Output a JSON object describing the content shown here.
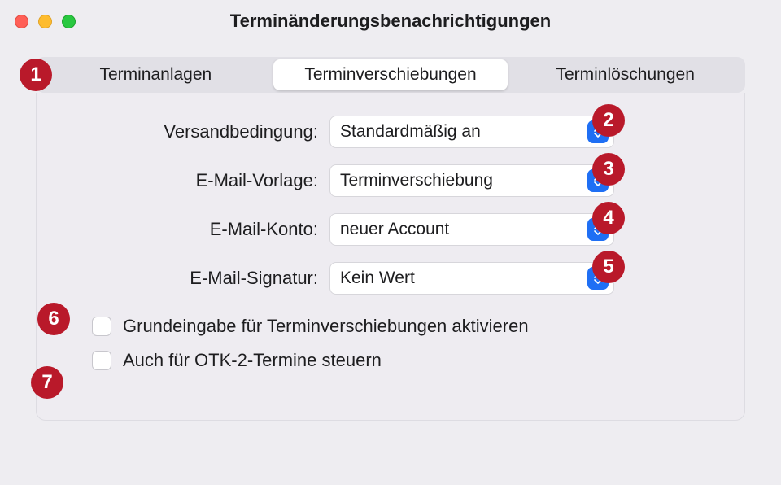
{
  "window": {
    "title": "Terminänderungsbenachrichtigungen"
  },
  "tabs": {
    "items": [
      {
        "label": "Terminanlagen"
      },
      {
        "label": "Terminverschiebungen"
      },
      {
        "label": "Terminlöschungen"
      }
    ],
    "active_index": 1
  },
  "form": {
    "rows": [
      {
        "label": "Versandbedingung:",
        "value": "Standardmäßig an"
      },
      {
        "label": "E-Mail-Vorlage:",
        "value": "Terminverschiebung"
      },
      {
        "label": "E-Mail-Konto:",
        "value": "neuer Account"
      },
      {
        "label": "E-Mail-Signatur:",
        "value": "Kein Wert"
      }
    ]
  },
  "checks": [
    {
      "label": "Grundeingabe für Terminverschiebungen aktivieren",
      "checked": false
    },
    {
      "label": "Auch für OTK-2-Termine steuern",
      "checked": false
    }
  ],
  "badges": [
    "1",
    "2",
    "3",
    "4",
    "5",
    "6",
    "7"
  ],
  "colors": {
    "accent": "#1f6ff4",
    "badge": "#b9192a"
  }
}
